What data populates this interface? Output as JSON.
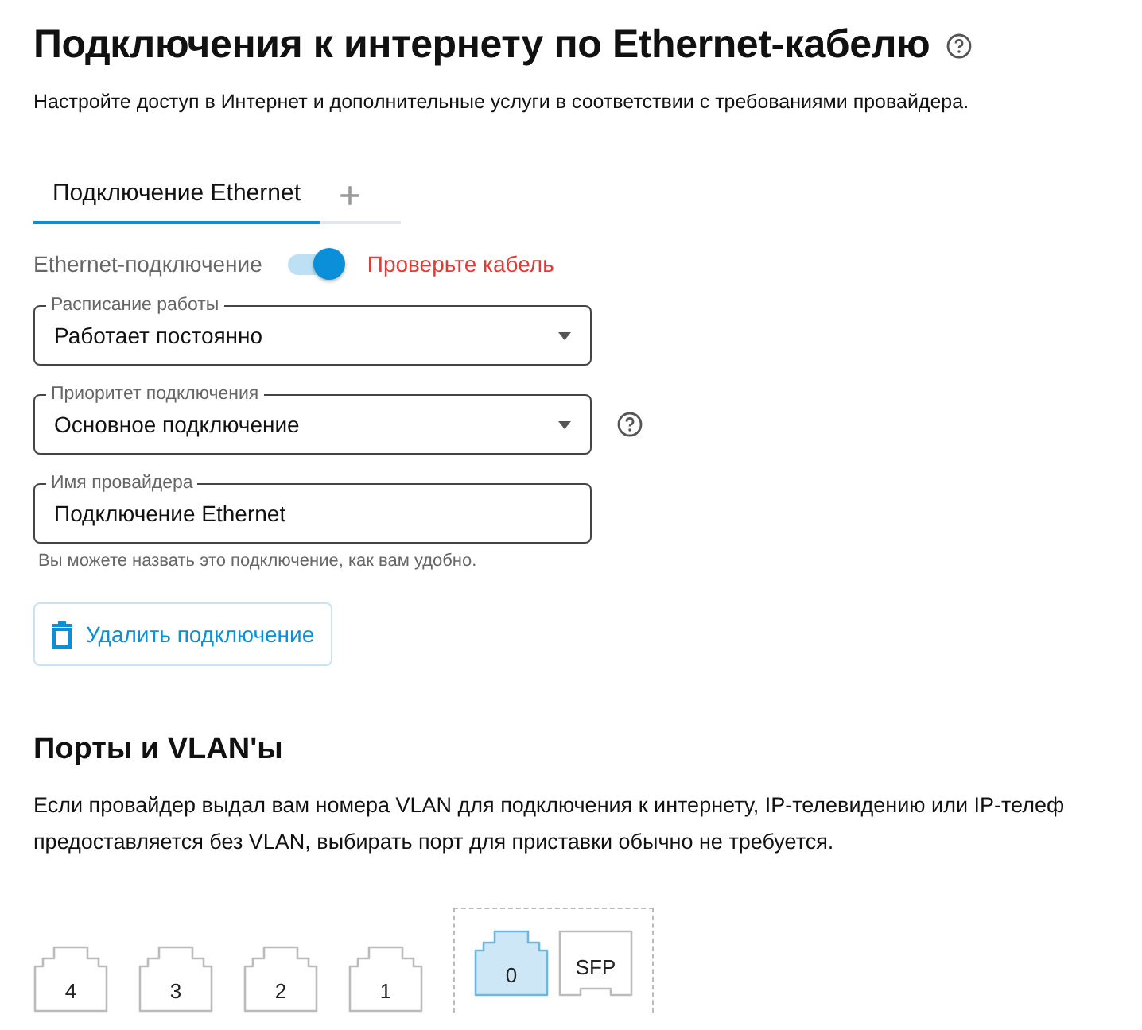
{
  "page": {
    "title": "Подключения к интернету по Ethernet-кабелю",
    "description": "Настройте доступ в Интернет и дополнительные услуги в соответствии с требованиями провайдера."
  },
  "tabs": [
    {
      "label": "Подключение Ethernet",
      "selected": true
    }
  ],
  "add_tab": {
    "label": "+"
  },
  "connection_toggle": {
    "label": "Ethernet-подключение",
    "on": true,
    "status": "Проверьте кабель"
  },
  "fields": [
    {
      "kind": "select",
      "label": "Расписание работы",
      "value": "Работает постоянно",
      "help": false
    },
    {
      "kind": "select",
      "label": "Приоритет подключения",
      "value": "Основное подключение",
      "help": true
    },
    {
      "kind": "text",
      "label": "Имя провайдера",
      "value": "Подключение Ethernet",
      "help": false,
      "hint": "Вы можете назвать это подключение, как вам удобно."
    }
  ],
  "delete_button": {
    "label": "Удалить подключение"
  },
  "ports_section": {
    "title": "Порты и VLAN'ы",
    "description": [
      "Если провайдер выдал вам номера VLAN для подключения к интернету, IP-телевидению или IP-телеф",
      "предоставляется без VLAN, выбирать порт для приставки обычно не требуется."
    ]
  },
  "ports": [
    {
      "label": "4",
      "kind": "lan",
      "selected": false
    },
    {
      "label": "3",
      "kind": "lan",
      "selected": false
    },
    {
      "label": "2",
      "kind": "lan",
      "selected": false
    },
    {
      "label": "1",
      "kind": "lan",
      "selected": false
    },
    {
      "label": "0",
      "kind": "wan",
      "selected": true
    },
    {
      "label": "SFP",
      "kind": "sfp",
      "selected": false
    }
  ]
}
